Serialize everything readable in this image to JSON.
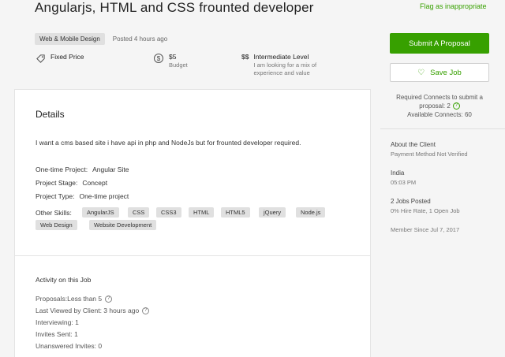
{
  "job": {
    "title": "Angularjs, HTML and CSS frounted developer",
    "flag_link": "Flag as inappropriate",
    "category": "Web & Mobile Design",
    "posted": "Posted 4 hours ago",
    "price_type": "Fixed Price",
    "budget_value": "$5",
    "budget_label": "Budget",
    "level_symbol": "$$",
    "level_title": "Intermediate Level",
    "level_desc_1": "I am looking for a mix of",
    "level_desc_2": "experience and value"
  },
  "details": {
    "heading": "Details",
    "description": "I want a cms based site i have api in php and NodeJs but for frounted developer required.",
    "one_time_label": "One-time Project:",
    "one_time_value": "Angular Site",
    "stage_label": "Project Stage:",
    "stage_value": "Concept",
    "type_label": "Project Type:",
    "type_value": "One-time project",
    "skills_label": "Other Skills:",
    "skills": [
      "AngularJS",
      "CSS",
      "CSS3",
      "HTML",
      "HTML5",
      "jQuery",
      "Node.js",
      "Web Design",
      "Website Development"
    ]
  },
  "activity": {
    "heading": "Activity on this Job",
    "proposals": "Proposals:Less than 5",
    "last_viewed": "Last Viewed by Client: 3 hours ago",
    "interviewing": "Interviewing: 1",
    "invites_sent": "Invites Sent: 1",
    "unanswered": "Unanswered Invites: 0"
  },
  "sidebar": {
    "submit_label": "Submit A Proposal",
    "save_label": "Save Job",
    "connects_required_1": "Required Connects to submit a",
    "connects_required_2": "proposal: 2",
    "connects_available": "Available Connects: 60",
    "about_heading": "About the Client",
    "payment": "Payment Method Not Verified",
    "country": "India",
    "time": "05:03 PM",
    "jobs_posted": "2 Jobs Posted",
    "hire_rate": "0% Hire Rate, 1 Open Job",
    "member_since": "Member Since Jul 7, 2017"
  },
  "icons": {
    "price": "price-tag-icon",
    "budget": "dollar-circle-icon",
    "save": "heart-icon",
    "help": "question-circle-icon"
  },
  "colors": {
    "accent": "#37a000"
  }
}
